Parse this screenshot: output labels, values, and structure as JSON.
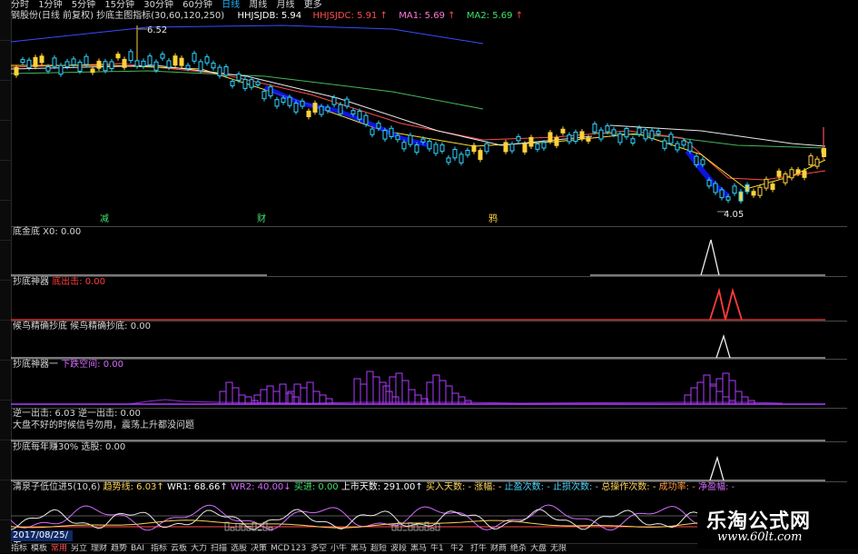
{
  "topbar": {
    "items": [
      "分时",
      "1分钟",
      "5分钟",
      "15分钟",
      "30分钟",
      "60分钟",
      "日线",
      "周线",
      "月线",
      "更多"
    ],
    "active_index": 6
  },
  "main": {
    "title": "钢股份(日线 前复权) 抄底主图指标(30,60,120,250)",
    "hhjsjdb": "HHJSJDB: 5.94",
    "hhjsjdc": "HHJSJDC: 5.91",
    "ma1": "MA1: 5.69",
    "ma2": "MA2: 5.69",
    "high_label": "6.52",
    "low_label": "4.05",
    "marks": [
      "减",
      "财",
      "鸦"
    ]
  },
  "panels": [
    {
      "parts": [
        {
          "text": "底金底  X0: 0.00",
          "color": "#d8d8d8"
        }
      ]
    },
    {
      "parts": [
        {
          "text": "抄底神器  ",
          "color": "#d8d8d8"
        },
        {
          "text": "底出击: 0.00",
          "color": "#ff3b3b"
        }
      ]
    },
    {
      "parts": [
        {
          "text": "候鸟精确抄底  候鸟精确抄底: 0.00",
          "color": "#d8d8d8"
        }
      ]
    },
    {
      "parts": [
        {
          "text": "抄底神器一  ",
          "color": "#d8d8d8"
        },
        {
          "text": "下跌空间: 0.00",
          "color": "#d46cff"
        }
      ]
    },
    {
      "parts": [
        {
          "text": "逆一出击: 6.03  逆一出击: 0.00",
          "color": "#d8d8d8"
        }
      ],
      "line2": "大盘不好的时候信号勿用，震荡上升都没问题"
    },
    {
      "parts": [
        {
          "text": "抄底每年赚30%  选股: 0.00",
          "color": "#d8d8d8"
        }
      ]
    },
    {
      "parts": [
        {
          "text": "清泉子低位进5(10,6)  ",
          "color": "#d8d8d8"
        },
        {
          "text": "趋势线: 6.03↑  ",
          "color": "#ffd65a"
        },
        {
          "text": "WR1: 68.66↑  ",
          "color": "#ffffff"
        },
        {
          "text": "WR2: 40.00↓  ",
          "color": "#d46cff"
        },
        {
          "text": "买进: 0.00  ",
          "color": "#3ee36a"
        },
        {
          "text": "上市天数: 291.00↑  ",
          "color": "#ffffff"
        },
        {
          "text": "买入天数: -  涨幅: -  ",
          "color": "#ffd65a"
        },
        {
          "text": "止盈次数: -  止损次数: -  ",
          "color": "#4ad7ff"
        },
        {
          "text": "总操作次数: -  ",
          "color": "#ffd65a"
        },
        {
          "text": "成功率: -  ",
          "color": "#ff9a3d"
        },
        {
          "text": "净盈幅: -",
          "color": "#d46cff"
        }
      ]
    }
  ],
  "date": "2017/08/25/五",
  "bottombar": {
    "items": [
      "指标",
      "模板",
      "常用",
      "另立",
      "理财",
      "趋势",
      "BAI",
      "指标",
      "云板",
      "大力",
      "扫描",
      "选股",
      "决策",
      "MCD",
      "123",
      "多空",
      "小牛",
      "黑马",
      "超短",
      "波段",
      "黑马",
      "牛1",
      "牛2",
      "打牛",
      "财商",
      "绝杀",
      "大盘",
      "无限"
    ],
    "active_index": 2
  },
  "watermark": {
    "cn": "乐淘公式网",
    "url": "www.60lt.com"
  },
  "colors": {
    "up": "#ffd23a",
    "down": "#2fd4ff",
    "deep_down": "#1018ff",
    "ma_red": "#ff4d4d",
    "ma_yellow": "#ffdd33",
    "ma_green": "#45b85a",
    "ma_blue": "#3a4bff",
    "ma_white": "#e8e8e8",
    "purple": "#b03bff",
    "wr2": "#d46cff"
  }
}
